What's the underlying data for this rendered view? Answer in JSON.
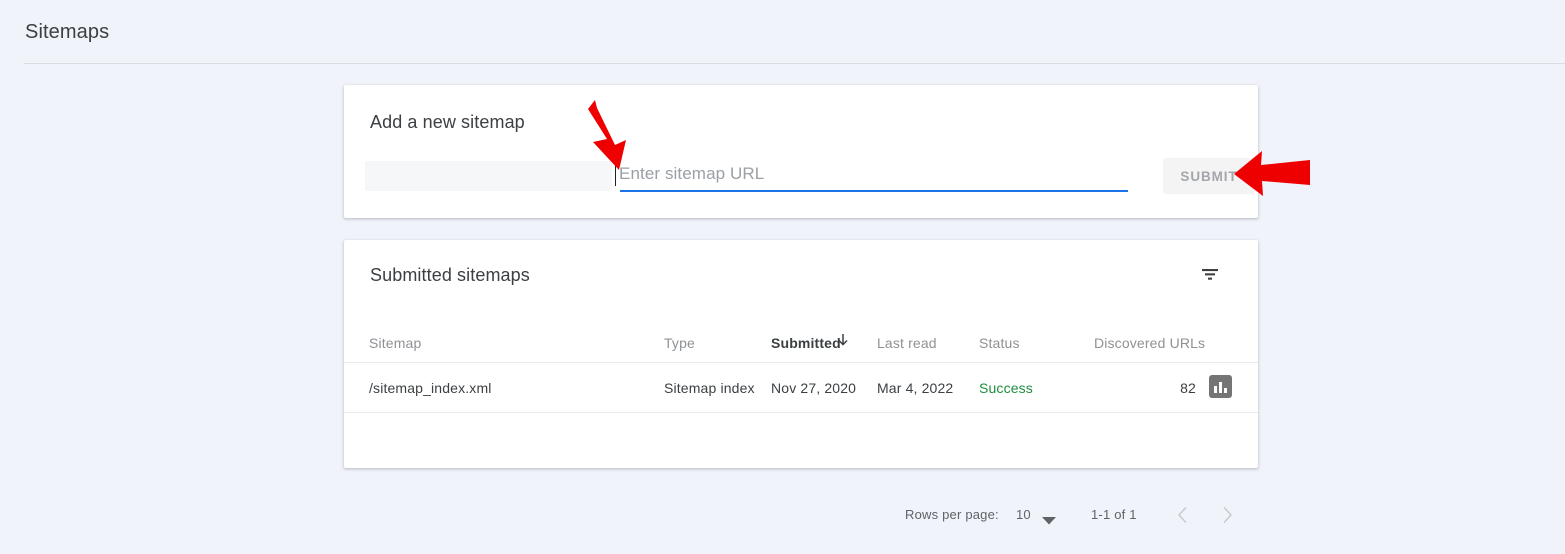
{
  "header": {
    "title": "Sitemaps"
  },
  "add_sitemap": {
    "title": "Add a new sitemap",
    "url_prefix": "",
    "url_value": "",
    "url_placeholder": "Enter sitemap URL",
    "submit_label": "SUBMIT",
    "accent_color": "#1a73e8"
  },
  "submitted_sitemaps": {
    "title": "Submitted sitemaps",
    "filter_icon": "filter-icon",
    "columns": [
      {
        "key": "sitemap",
        "label": "Sitemap",
        "sorted": false
      },
      {
        "key": "type",
        "label": "Type",
        "sorted": false
      },
      {
        "key": "submitted",
        "label": "Submitted",
        "sorted": true,
        "sort_direction": "descending"
      },
      {
        "key": "last_read",
        "label": "Last read",
        "sorted": false
      },
      {
        "key": "status",
        "label": "Status",
        "sorted": false
      },
      {
        "key": "discovered_urls",
        "label": "Discovered URLs",
        "sorted": false
      }
    ],
    "rows": [
      {
        "sitemap": "/sitemap_index.xml",
        "type": "Sitemap index",
        "submitted": "Nov 27, 2020",
        "last_read": "Mar 4, 2022",
        "status": "Success",
        "status_color": "#1e8e3e",
        "discovered_urls": "82",
        "action_icon": "bar-chart-icon"
      }
    ],
    "pagination": {
      "rows_per_page_label": "Rows per page:",
      "rows_per_page_value": "10",
      "range_label": "1-1 of 1",
      "prev_icon": "chevron-left-icon",
      "next_icon": "chevron-right-icon"
    }
  },
  "annotations": [
    {
      "name": "arrow-pointing-to-url-input",
      "color": "#ee0000",
      "direction": "down-right"
    },
    {
      "name": "arrow-pointing-to-submit-button",
      "color": "#ee0000",
      "direction": "left"
    }
  ]
}
